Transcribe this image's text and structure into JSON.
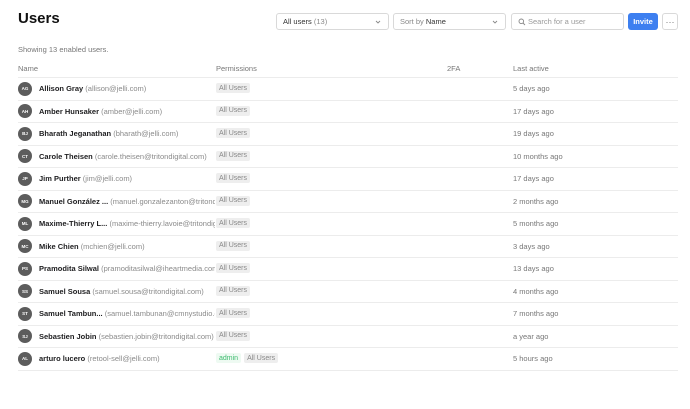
{
  "page": {
    "title": "Users"
  },
  "toolbar": {
    "filter_label": "All users",
    "filter_count": "(13)",
    "sort_prefix": "Sort by",
    "sort_value": "Name",
    "search_placeholder": "Search for a user",
    "invite_label": "Invite",
    "more_label": "···"
  },
  "summary": {
    "showing_prefix": "Showing",
    "showing_count": "13",
    "showing_suffix": "enabled users."
  },
  "table": {
    "headers": {
      "name": "Name",
      "permissions": "Permissions",
      "twofa": "2FA",
      "last_active": "Last active"
    },
    "rows": [
      {
        "initials": "AG",
        "name": "Allison Gray",
        "email": "(allison@jelli.com)",
        "permissions": [
          "All Users"
        ],
        "admin": "",
        "last_active": "5 days ago"
      },
      {
        "initials": "AH",
        "name": "Amber Hunsaker",
        "email": "(amber@jelli.com)",
        "permissions": [
          "All Users"
        ],
        "admin": "",
        "last_active": "17 days ago"
      },
      {
        "initials": "BJ",
        "name": "Bharath Jeganathan",
        "email": "(bharath@jelli.com)",
        "permissions": [
          "All Users"
        ],
        "admin": "",
        "last_active": "19 days ago"
      },
      {
        "initials": "CT",
        "name": "Carole Theisen",
        "email": "(carole.theisen@tritondigital.com)",
        "permissions": [
          "All Users"
        ],
        "admin": "",
        "last_active": "10 months ago"
      },
      {
        "initials": "JP",
        "name": "Jim Purther",
        "email": "(jim@jelli.com)",
        "permissions": [
          "All Users"
        ],
        "admin": "",
        "last_active": "17 days ago"
      },
      {
        "initials": "MG",
        "name": "Manuel González ...",
        "email": "(manuel.gonzalezanton@tritondi...",
        "permissions": [
          "All Users"
        ],
        "admin": "",
        "last_active": "2 months ago"
      },
      {
        "initials": "ML",
        "name": "Maxime-Thierry L...",
        "email": "(maxime-thierry.lavoie@tritondigi...",
        "permissions": [
          "All Users"
        ],
        "admin": "",
        "last_active": "5 months ago"
      },
      {
        "initials": "MC",
        "name": "Mike Chien",
        "email": "(mchien@jelli.com)",
        "permissions": [
          "All Users"
        ],
        "admin": "",
        "last_active": "3 days ago"
      },
      {
        "initials": "PS",
        "name": "Pramodita Silwal",
        "email": "(pramoditasilwal@iheartmedia.com)",
        "permissions": [
          "All Users"
        ],
        "admin": "",
        "last_active": "13 days ago"
      },
      {
        "initials": "SS",
        "name": "Samuel Sousa",
        "email": "(samuel.sousa@tritondigital.com)",
        "permissions": [
          "All Users"
        ],
        "admin": "",
        "last_active": "4 months ago"
      },
      {
        "initials": "ST",
        "name": "Samuel Tambun...",
        "email": "(samuel.tambunan@cmnystudio.co...",
        "permissions": [
          "All Users"
        ],
        "admin": "",
        "last_active": "7 months ago"
      },
      {
        "initials": "SJ",
        "name": "Sebastien Jobin",
        "email": "(sebastien.jobin@tritondigital.com)",
        "permissions": [
          "All Users"
        ],
        "admin": "",
        "last_active": "a year ago"
      },
      {
        "initials": "AL",
        "name": "arturo lucero",
        "email": "(retool-sell@jelli.com)",
        "permissions": [
          "All Users"
        ],
        "admin": "admin",
        "last_active": "5 hours ago"
      }
    ]
  }
}
